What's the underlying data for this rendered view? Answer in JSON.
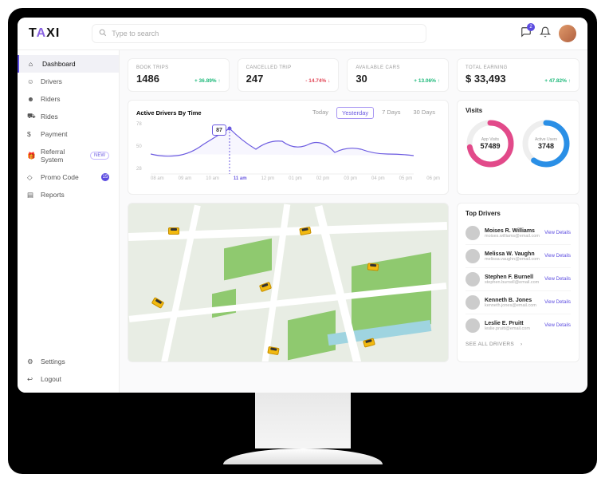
{
  "header": {
    "logo": "TAXI",
    "search_placeholder": "Type to search",
    "notif_count": "2"
  },
  "sidebar": {
    "items": [
      {
        "icon": "home",
        "label": "Dashboard"
      },
      {
        "icon": "user",
        "label": "Drivers"
      },
      {
        "icon": "users",
        "label": "Riders"
      },
      {
        "icon": "car",
        "label": "Rides"
      },
      {
        "icon": "dollar",
        "label": "Payment"
      },
      {
        "icon": "gift",
        "label": "Referral System",
        "pill": "NEW"
      },
      {
        "icon": "tag",
        "label": "Promo Code",
        "dot": "15"
      },
      {
        "icon": "report",
        "label": "Reports"
      }
    ],
    "settings": "Settings",
    "logout": "Logout"
  },
  "stats": [
    {
      "label": "BOOK TRIPS",
      "value": "1486",
      "delta": "+ 36.89%",
      "dir": "up"
    },
    {
      "label": "CANCELLED TRIP",
      "value": "247",
      "delta": "- 14.74%",
      "dir": "down"
    },
    {
      "label": "AVAILABLE CARS",
      "value": "30",
      "delta": "+ 13.06%",
      "dir": "up"
    },
    {
      "label": "TOTAL EARNING",
      "value": "$ 33,493",
      "delta": "+ 47.82%",
      "dir": "up"
    }
  ],
  "chart": {
    "title": "Active Drivers By Time",
    "filters": [
      "Today",
      "Yesterday",
      "7 Days",
      "30 Days"
    ],
    "active_filter": "Yesterday",
    "y_ticks": [
      "28",
      "50",
      "78"
    ],
    "x_labels": [
      "08 am",
      "09 am",
      "10 am",
      "11 am",
      "12 pm",
      "01 pm",
      "02 pm",
      "03 pm",
      "04 pm",
      "05 pm",
      "06 pm"
    ],
    "active_x": "11 am",
    "callout": "87"
  },
  "chart_data": {
    "type": "line",
    "title": "Active Drivers By Time",
    "x": [
      "08 am",
      "09 am",
      "10 am",
      "11 am",
      "12 pm",
      "01 pm",
      "02 pm",
      "03 pm",
      "04 pm",
      "05 pm",
      "06 pm"
    ],
    "values": [
      55,
      52,
      68,
      87,
      62,
      74,
      60,
      70,
      57,
      63,
      54
    ],
    "ylim": [
      28,
      90
    ],
    "highlight": {
      "x": "11 am",
      "value": 87
    }
  },
  "visits": {
    "title": "Visits",
    "app": {
      "label": "App Visits",
      "value": "57489",
      "pct": 0.72,
      "color": "#e24a8a"
    },
    "active": {
      "label": "Active Users",
      "value": "3748",
      "pct": 0.6,
      "color": "#2a8fe6"
    }
  },
  "drivers": {
    "title": "Top Drivers",
    "view_details": "View Details",
    "see_all": "SEE ALL DRIVERS",
    "list": [
      {
        "name": "Moises R. Williams",
        "email": "moises.williams@email.com"
      },
      {
        "name": "Melissa W. Vaughn",
        "email": "melissa.vaughn@email.com"
      },
      {
        "name": "Stephen F. Burnell",
        "email": "stephen.burnell@email.com"
      },
      {
        "name": "Kenneth B. Jones",
        "email": "kenneth.jones@email.com"
      },
      {
        "name": "Leslie E. Pruitt",
        "email": "leslie.pruitt@email.com"
      }
    ]
  }
}
